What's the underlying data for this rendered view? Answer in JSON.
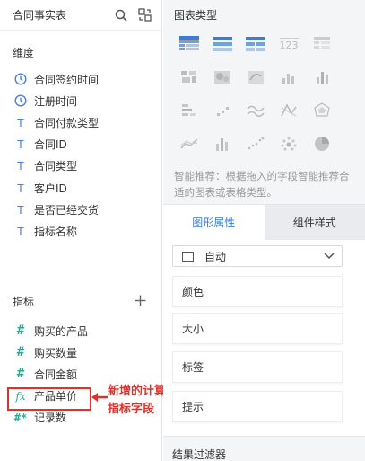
{
  "left_panel": {
    "title": "合同事实表",
    "dimensions_title": "维度",
    "dimensions": [
      {
        "label": "合同签约时间",
        "type": "time"
      },
      {
        "label": "注册时间",
        "type": "time"
      },
      {
        "label": "合同付款类型",
        "type": "text"
      },
      {
        "label": "合同ID",
        "type": "text"
      },
      {
        "label": "合同类型",
        "type": "text"
      },
      {
        "label": "客户ID",
        "type": "text"
      },
      {
        "label": "是否已经交货",
        "type": "text"
      },
      {
        "label": "指标名称",
        "type": "text"
      }
    ],
    "measures_title": "指标",
    "measures": [
      {
        "label": "购买的产品",
        "type": "number"
      },
      {
        "label": "购买数量",
        "type": "number"
      },
      {
        "label": "合同金额",
        "type": "number"
      },
      {
        "label": "产品单价",
        "type": "calculated"
      },
      {
        "label": "记录数",
        "type": "count"
      }
    ],
    "annotation_line1": "新增的计算",
    "annotation_line2": "指标字段",
    "icons": {
      "T": "T",
      "hash": "#",
      "fx": "fx",
      "count": "#*"
    }
  },
  "right_panel": {
    "chart_types_title": "图表类型",
    "chart_type_icons": [
      "table-icon",
      "cross-table-icon",
      "detail-table-icon",
      "kpi-number-icon",
      "grouped-table-icon",
      "map-icon",
      "heatmap-icon",
      "flow-map-icon",
      "bar-chart-icon",
      "grouped-bar-icon",
      "stacked-bar-icon",
      "scatter-small-icon",
      "line-icon",
      "radar-icon",
      "polar-icon",
      "area-icon",
      "column-icon",
      "scatter-icon",
      "point-cloud-icon",
      "pie-icon"
    ],
    "kpi_text": "123",
    "hint": "智能推荐：根据拖入的字段智能推荐合适的图表或表格类型。",
    "tabs": [
      {
        "label": "图形属性",
        "active": true
      },
      {
        "label": "组件样式",
        "active": false
      }
    ],
    "select_value": "自动",
    "properties": [
      "颜色",
      "大小",
      "标签",
      "提示"
    ],
    "filter_title": "结果过滤器"
  },
  "colors": {
    "accent_blue": "#3d7bd9",
    "field_green": "#35a694",
    "annotation_red": "#e0312b"
  }
}
